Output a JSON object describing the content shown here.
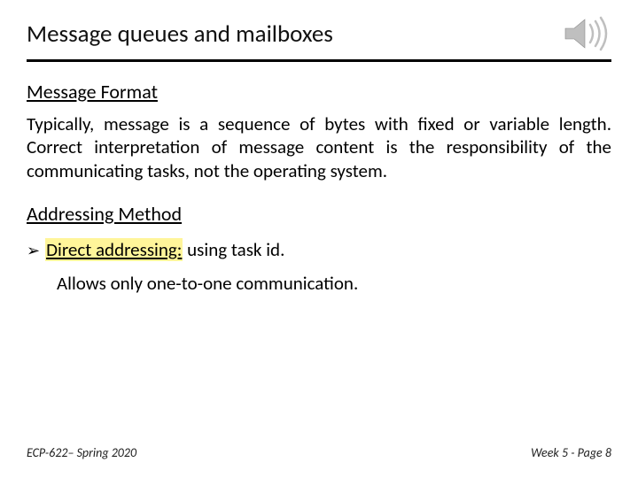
{
  "title": "Message queues and mailboxes",
  "section1_heading": "Message Format",
  "section1_body": "Typically, message is a sequence of bytes with fixed or variable length.  Correct interpretation of message content is the responsibility of the communicating tasks, not the operating system.",
  "section2_heading": "Addressing  Method",
  "bullet_term": "Direct addressing:",
  "bullet_rest": " using task id.",
  "bullet_detail": "Allows only one-to-one communication.",
  "footer_left": "ECP-622– Spring 2020",
  "footer_right": "Week 5 - Page 8",
  "icons": {
    "speaker": "speaker-icon"
  }
}
